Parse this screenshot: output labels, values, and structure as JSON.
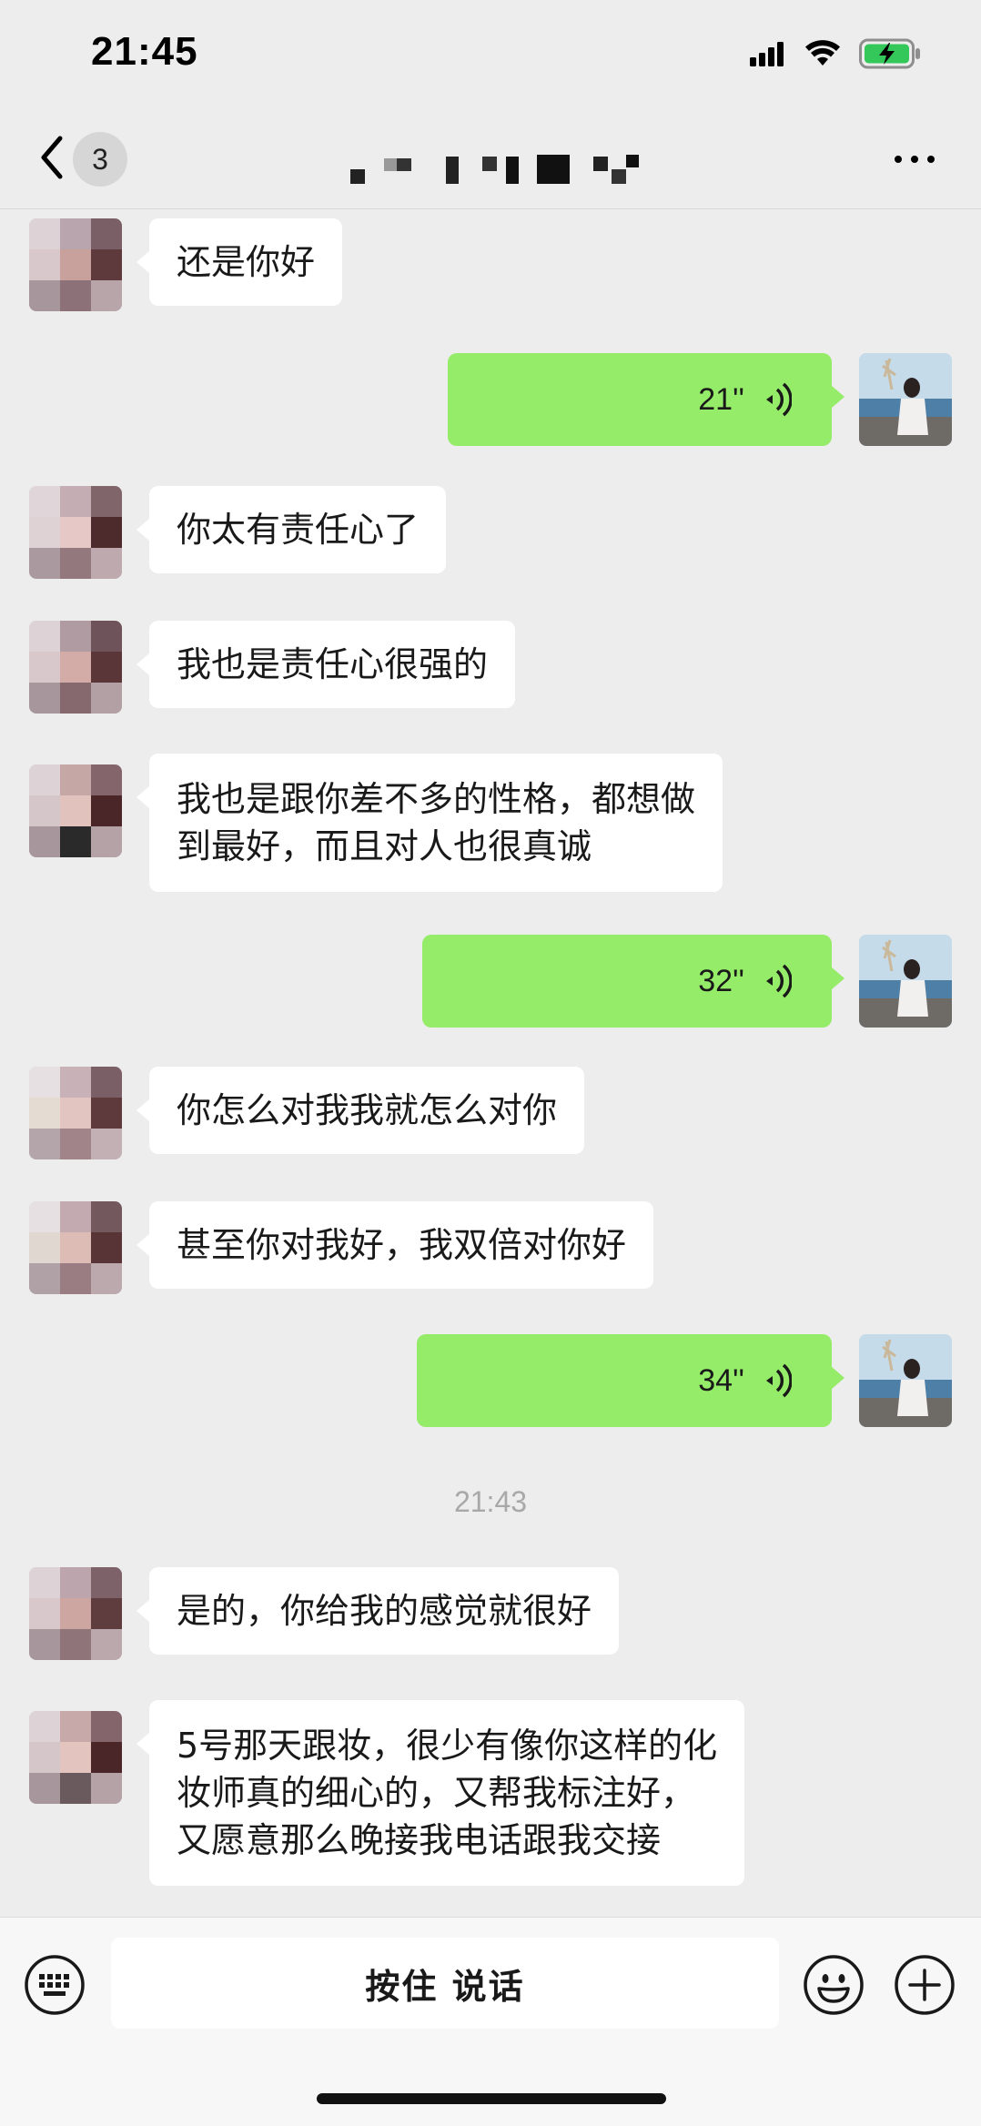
{
  "status_bar": {
    "time": "21:45",
    "icons": [
      "signal-icon",
      "wifi-icon",
      "battery-charging-icon"
    ]
  },
  "nav": {
    "unread_count": "3",
    "title": "",
    "more_icon": "more-dots-icon"
  },
  "colors": {
    "background": "#ededed",
    "incoming_bubble": "#ffffff",
    "outgoing_bubble": "#95ec69",
    "timestamp_text": "#a8a8a8"
  },
  "messages": [
    {
      "side": "left",
      "type": "text",
      "text": "还是你好"
    },
    {
      "side": "right",
      "type": "voice",
      "duration": "21''"
    },
    {
      "side": "left",
      "type": "text",
      "text": "你太有责任心了"
    },
    {
      "side": "left",
      "type": "text",
      "text": "我也是责任心很强的"
    },
    {
      "side": "left",
      "type": "text",
      "lines": [
        "我也是跟你差不多的性格，都想做",
        "到最好，而且对人也很真诚"
      ]
    },
    {
      "side": "right",
      "type": "voice",
      "duration": "32''"
    },
    {
      "side": "left",
      "type": "text",
      "text": "你怎么对我我就怎么对你"
    },
    {
      "side": "left",
      "type": "text",
      "text": "甚至你对我好，我双倍对你好"
    },
    {
      "side": "right",
      "type": "voice",
      "duration": "34''"
    },
    {
      "type": "timestamp",
      "text": "21:43"
    },
    {
      "side": "left",
      "type": "text",
      "text": "是的，你给我的感觉就很好"
    },
    {
      "side": "left",
      "type": "text",
      "lines": [
        "5号那天跟妆，很少有像你这样的化",
        "妆师真的细心的，又帮我标注好，",
        "又愿意那么晚接我电话跟我交接"
      ]
    }
  ],
  "input_bar": {
    "talk_label": "按住 说话",
    "left_icon": "keyboard-icon",
    "emoji_icon": "emoji-icon",
    "plus_icon": "plus-icon"
  }
}
